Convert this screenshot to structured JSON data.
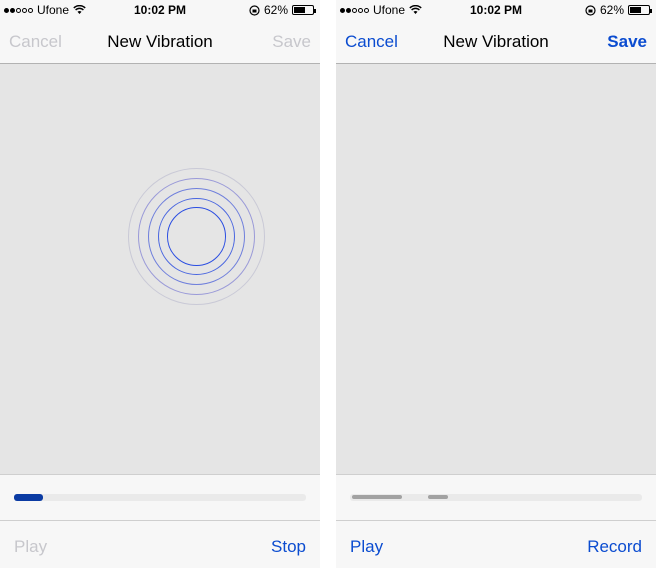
{
  "status": {
    "carrier": "Ufone",
    "time": "10:02 PM",
    "battery": "62%",
    "battery_level": 0.62
  },
  "colors": {
    "accent": "#0b4cd0",
    "disabled": "#c7c7cc",
    "progress_fill": "#0b3ba3",
    "segment": "#a2a2a2",
    "background": "#e5e5e5",
    "bar": "#f7f7f7"
  },
  "left": {
    "nav": {
      "cancel": "Cancel",
      "title": "New Vibration",
      "save": "Save"
    },
    "toolbar": {
      "play": "Play",
      "stop": "Stop"
    },
    "progress": 0.1
  },
  "right": {
    "nav": {
      "cancel": "Cancel",
      "title": "New Vibration",
      "save": "Save"
    },
    "toolbar": {
      "play": "Play",
      "record": "Record"
    }
  }
}
